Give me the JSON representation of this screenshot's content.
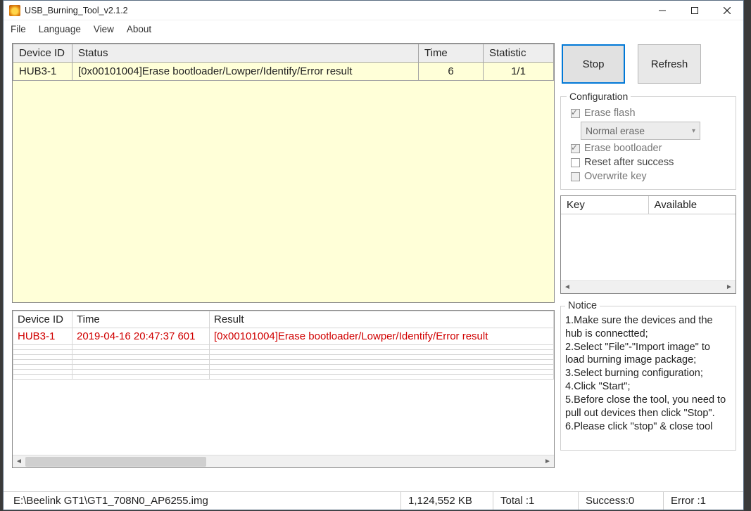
{
  "window": {
    "title": "USB_Burning_Tool_v2.1.2"
  },
  "menu": {
    "file": "File",
    "language": "Language",
    "view": "View",
    "about": "About"
  },
  "dev_table": {
    "headers": {
      "device": "Device ID",
      "status": "Status",
      "time": "Time",
      "stat": "Statistic"
    },
    "rows": [
      {
        "device": "HUB3-1",
        "status": "[0x00101004]Erase bootloader/Lowper/Identify/Error result",
        "time": "6",
        "stat": "1/1"
      }
    ]
  },
  "log_table": {
    "headers": {
      "device": "Device ID",
      "time": "Time",
      "result": "Result"
    },
    "rows": [
      {
        "device": "HUB3-1",
        "time": "2019-04-16 20:47:37 601",
        "result": "[0x00101004]Erase bootloader/Lowper/Identify/Error result"
      }
    ]
  },
  "buttons": {
    "stop": "Stop",
    "refresh": "Refresh"
  },
  "config": {
    "title": "Configuration",
    "erase_flash": "Erase flash",
    "erase_mode": "Normal erase",
    "erase_bootloader": "Erase bootloader",
    "reset_after": "Reset after success",
    "overwrite_key": "Overwrite key"
  },
  "key_panel": {
    "key": "Key",
    "available": "Available"
  },
  "notice": {
    "title": "Notice",
    "l1": "1.Make sure the devices and the hub is connectted;",
    "l2": "2.Select \"File\"-\"Import image\" to load burning image package;",
    "l3": "3.Select burning configuration;",
    "l4": "4.Click \"Start\";",
    "l5": "5.Before close the tool, you need to pull out devices then click \"Stop\".",
    "l6": "6.Please click \"stop\" & close tool"
  },
  "status": {
    "path": "E:\\Beelink GT1\\GT1_708N0_AP6255.img",
    "size": "1,124,552 KB",
    "total": "Total :1",
    "success": "Success:0",
    "error": "Error :1"
  }
}
